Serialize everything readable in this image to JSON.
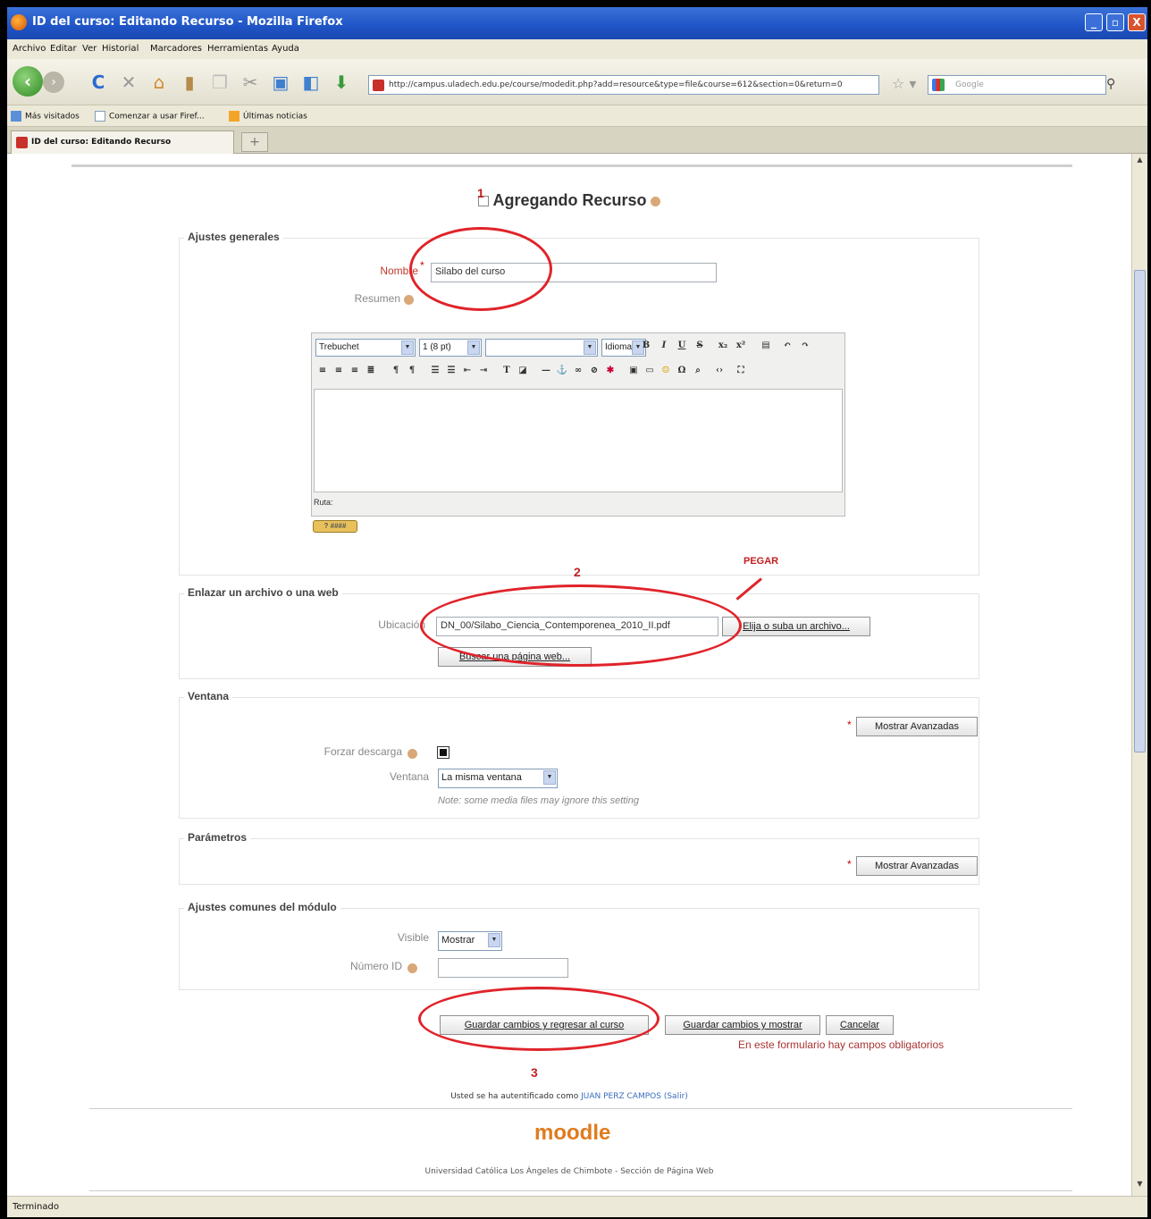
{
  "window": {
    "title": "ID del curso: Editando Recurso - Mozilla Firefox",
    "controls": [
      "_",
      "▫",
      "X"
    ]
  },
  "menu": [
    "Archivo",
    "Editar",
    "Ver",
    "Historial",
    "Marcadores",
    "Herramientas",
    "Ayuda"
  ],
  "nav": {
    "url": "http://campus.uladech.edu.pe/course/modedit.php?add=resource&type=file&course=612&section=0&return=0",
    "search_placeholder": "Google"
  },
  "bookmarks": [
    "Más visitados",
    "Comenzar a usar Firef...",
    "Últimas noticias"
  ],
  "tab": {
    "label": "ID del curso: Editando Recurso",
    "new_tab": "+"
  },
  "page": {
    "heading": "Agregando Recurso",
    "general": {
      "legend": "Ajustes generales",
      "name_label": "Nombre",
      "name_value": "Silabo del curso",
      "summary_label": "Resumen",
      "editor": {
        "font": "Trebuchet",
        "size": "1 (8 pt)",
        "lang": "Idioma",
        "path": "Ruta:",
        "help": "? ####"
      }
    },
    "link": {
      "legend": "Enlazar un archivo o una web",
      "location_label": "Ubicación",
      "location_value": "DN_00/Silabo_Ciencia_Contemporenea_2010_II.pdf",
      "choose_button": "Elija o suba un archivo...",
      "search_web_button": "Buscar una página web..."
    },
    "window_section": {
      "legend": "Ventana",
      "advanced_button": "Mostrar Avanzadas",
      "force_download_label": "Forzar descarga",
      "window_label": "Ventana",
      "window_value": "La misma ventana",
      "note": "Note: some media files may ignore this setting"
    },
    "params": {
      "legend": "Parámetros",
      "advanced_button": "Mostrar Avanzadas"
    },
    "common": {
      "legend": "Ajustes comunes del módulo",
      "visible_label": "Visible",
      "visible_value": "Mostrar",
      "id_label": "Número ID"
    },
    "buttons": {
      "save_return": "Guardar cambios y regresar al curso",
      "save_show": "Guardar cambios y mostrar",
      "cancel": "Cancelar"
    },
    "required_note": "En este formulario hay campos obligatorios",
    "annotations": {
      "n1": "1",
      "n2": "2",
      "n3": "3",
      "paste": "PEGAR"
    },
    "login_prefix": "Usted se ha autentificado como",
    "login_user": "JUAN PERZ CAMPOS",
    "logout": "(Salir)",
    "logo": "moodle",
    "footer": "Universidad Católica Los Ángeles de Chimbote - Sección de Página Web"
  },
  "status": "Terminado",
  "colors": {
    "annotation": "#e0232a",
    "moodle": "#e07b1e",
    "titlebar": "#1f54c6"
  }
}
